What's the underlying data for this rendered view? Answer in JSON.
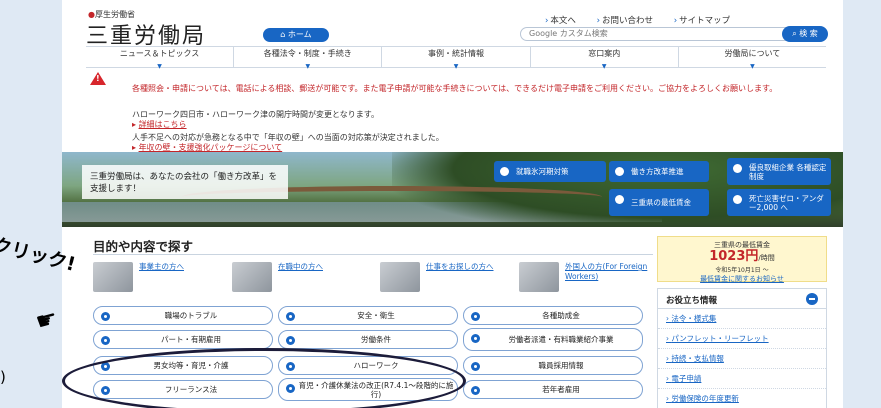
{
  "header": {
    "ministry": "厚生労働省",
    "site_title": "三重労働局",
    "home_label": "ホーム",
    "top_links": [
      "本文へ",
      "お問い合わせ",
      "サイトマップ"
    ],
    "search_placeholder": "Google カスタム検索",
    "search_button": "検 索"
  },
  "nav": [
    "ニュース＆トピックス",
    "各種法令・制度・手続き",
    "事例・統計情報",
    "窓口案内",
    "労働局について"
  ],
  "notices": {
    "line1": "各種照会・申請については、電話による相談、郵送が可能です。また電子申請が可能な手続きについては、できるだけ電子申請をご利用ください。ご協力をよろしくお願いします。",
    "line2": "ハローワーク四日市・ハローワーク津の開庁時間が変更となります。",
    "link2": "詳細はこちら",
    "line3": "人手不足への対応が急務となる中で「年収の壁」への当面の対応策が決定されました。",
    "link3": "年収の壁・支援強化パッケージについて"
  },
  "banner": {
    "text": "三重労働局は、あなたの会社の「働き方改革」を支援します！",
    "buttons": [
      "就職氷河期対策",
      "働き方改革推進",
      "優良取組企業 各種認定制度",
      "三重県の最低賃金",
      "死亡災害ゼロ・アンダー2,000 へ"
    ]
  },
  "purpose": {
    "title": "目的や内容で探す",
    "audiences": [
      "事業主の方へ",
      "在職中の方へ",
      "仕事をお探しの方へ",
      "外国人の方(For Foreign Workers)"
    ],
    "buttons": [
      "職場のトラブル",
      "安全・衛生",
      "各種助成金",
      "パート・有期雇用",
      "労働条件",
      "労働者派遣・有料職業紹介事業",
      "男女均等・育児・介護",
      "ハローワーク",
      "職員採用情報",
      "フリーランス法",
      "育児・介護休業法の改正(R7.4.1～段階的に施行)",
      "若年者雇用"
    ]
  },
  "wage": {
    "label": "三重県の最低賃金",
    "value": "1023円",
    "unit": "/時間",
    "date": "令和5年10月1日 〜",
    "link": "最低賃金に関するお知らせ"
  },
  "useful": {
    "title": "お役立ち情報",
    "items": [
      "法令・様式集",
      "パンフレット・リーフレット",
      "持続・支払情報",
      "電子申請",
      "労働保険の年度更新"
    ]
  },
  "annotations": {
    "click": "クリック!",
    "paren": ")"
  }
}
